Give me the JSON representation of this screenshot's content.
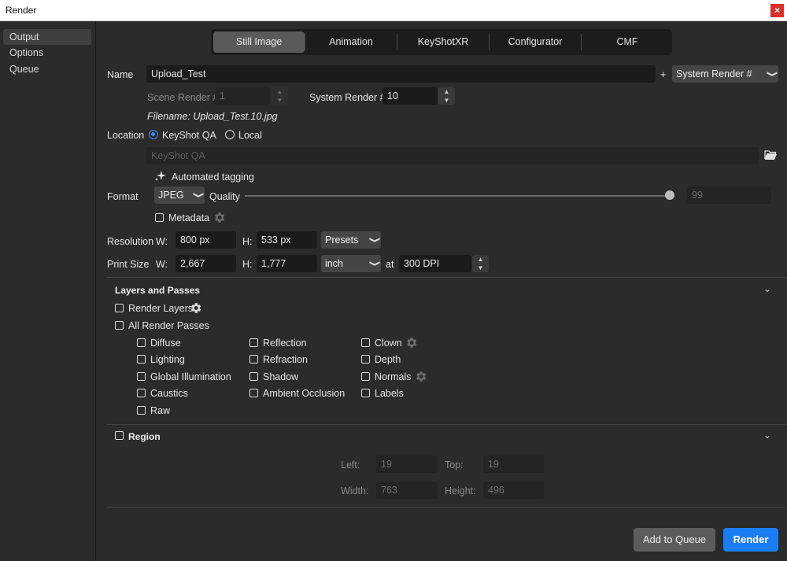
{
  "window": {
    "title": "Render",
    "close_label": "×"
  },
  "sidebar": {
    "items": [
      {
        "label": "Output",
        "active": true
      },
      {
        "label": "Options",
        "active": false
      },
      {
        "label": "Queue",
        "active": false
      }
    ]
  },
  "tabs": [
    {
      "label": "Still Image",
      "active": true
    },
    {
      "label": "Animation",
      "active": false
    },
    {
      "label": "KeyShotXR",
      "active": false
    },
    {
      "label": "Configurator",
      "active": false
    },
    {
      "label": "CMF",
      "active": false
    }
  ],
  "name": {
    "label": "Name",
    "value": "Upload_Test",
    "plus": "+",
    "suffix_dropdown": "System Render #",
    "scene_render_label": "Scene Render #",
    "scene_render_value": "1",
    "system_render_label": "System Render #",
    "system_render_value": "10",
    "filename": "Filename: Upload_Test.10.jpg"
  },
  "location": {
    "label": "Location",
    "option_keyshot": "KeyShot QA",
    "option_local": "Local",
    "selected": "KeyShot QA",
    "path_placeholder": "KeyShot QA",
    "auto_tagging": "Automated tagging"
  },
  "format": {
    "label": "Format",
    "value": "JPEG",
    "quality_label": "Quality",
    "quality_value": "99",
    "quality_fraction": 0.99,
    "metadata_label": "Metadata"
  },
  "resolution": {
    "label": "Resolution",
    "w_label": "W:",
    "w_value": "800 px",
    "h_label": "H:",
    "h_value": "533 px",
    "presets": "Presets"
  },
  "print_size": {
    "label": "Print Size",
    "w_label": "W:",
    "w_value": "2,667",
    "h_label": "H:",
    "h_value": "1,777",
    "unit": "inch",
    "at_label": "at",
    "dpi_value": "300 DPI"
  },
  "layers": {
    "title": "Layers and Passes",
    "render_layers": "Render Layers",
    "all_passes": "All Render Passes",
    "col1": [
      "Diffuse",
      "Lighting",
      "Global Illumination",
      "Caustics",
      "Raw"
    ],
    "col2": [
      "Reflection",
      "Refraction",
      "Shadow",
      "Ambient Occlusion"
    ],
    "col3": [
      "Clown",
      "Depth",
      "Normals",
      "Labels"
    ]
  },
  "region": {
    "title": "Region",
    "left_label": "Left:",
    "left_value": "19",
    "top_label": "Top:",
    "top_value": "19",
    "width_label": "Width:",
    "width_value": "763",
    "height_label": "Height:",
    "height_value": "496"
  },
  "footer": {
    "add_to_queue": "Add to Queue",
    "render": "Render"
  },
  "colors": {
    "accent": "#1a7df4",
    "close": "#d9302a",
    "background": "#2b2b2b"
  }
}
